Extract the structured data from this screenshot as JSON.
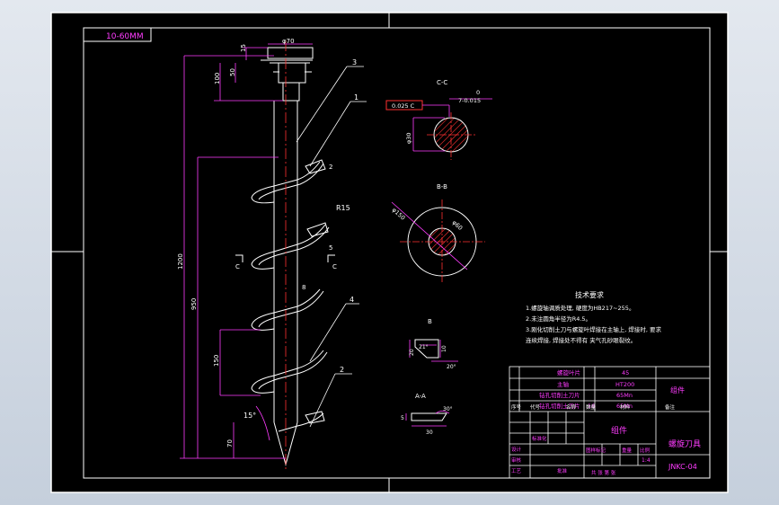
{
  "drawing_id_box": "10-60MM",
  "dims": {
    "top_dia": "φ70",
    "d15": "15",
    "d100": "100",
    "d50": "50",
    "d1200": "1200",
    "d950": "950",
    "d150": "150",
    "d70": "70",
    "angle15": "15°",
    "r15": "R15",
    "d2": "2",
    "d5": "5",
    "d8": "8"
  },
  "callouts": [
    "3",
    "1",
    "4",
    "2"
  ],
  "section_marks": {
    "c_left": "C",
    "c_right": "C"
  },
  "section_cc": {
    "title": "C-C",
    "tolerance": "0.025 C",
    "dim_top": "0",
    "dim_tol": "7-0.015",
    "dim_side": "φ30"
  },
  "section_bb": {
    "title": "B-B",
    "outer_dia": "φ150",
    "inner_dia": "φ60"
  },
  "detail_b": {
    "title": "B",
    "dims": [
      "21°",
      "10",
      "20",
      "20°"
    ]
  },
  "section_aa": {
    "title": "A-A",
    "dims": [
      "30°",
      "5",
      "30"
    ]
  },
  "notes": {
    "title": "技术要求",
    "lines": [
      "1.螺旋轴调质处理, 硬度为HB217~255。",
      "2.未注圆角半径为R4.5。",
      "3.刚化切削土刀与螺旋叶焊接在主轴上, 焊接时, 要求",
      "  连续焊接, 焊接处不得有        夹气孔砂眼裂纹。"
    ]
  },
  "title_block": {
    "parts_rows": [
      [
        "4",
        "螺旋叶片",
        "",
        "45"
      ],
      [
        "3",
        "主轴",
        "",
        "HT200"
      ],
      [
        "2",
        "钻孔切削土刀片",
        "",
        "65Mn"
      ],
      [
        "1",
        "钻孔切削土刀片",
        "16",
        "65Mn"
      ]
    ],
    "assembly_label": "组件",
    "headers": [
      "序号",
      "代号",
      "名称",
      "数量",
      "材料",
      "备注"
    ],
    "part_name": "螺旋刀具",
    "drawing_no": "JNKC-04",
    "material_label": "组件",
    "scale_label": "比例",
    "scale_value": "1:4",
    "weight_label": "图样标记",
    "qty_label": "重量",
    "sheet_label": "共  张 第  张",
    "designer_label": "设计",
    "checker_label": "审核",
    "approver_label": "批准",
    "std_label": "标准化",
    "process_label": "工艺"
  },
  "colors": {
    "paper": "#000000",
    "outline": "#ffffff",
    "dimension": "#ff3cff",
    "center": "#ff3030",
    "frame_border": "#0000ff",
    "hatch": "#ff3030"
  }
}
